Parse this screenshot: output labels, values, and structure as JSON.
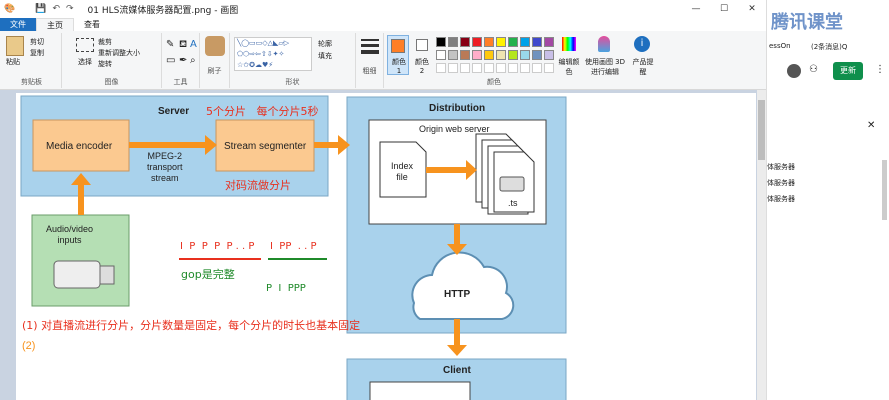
{
  "window": {
    "title": "01 HLS流媒体服务器配置.png - 画图",
    "minimize": "—",
    "maximize": "☐",
    "close": "✕"
  },
  "tabs": {
    "file": "文件",
    "home": "主页",
    "view": "查看"
  },
  "ribbon": {
    "clipboard": {
      "paste": "粘贴",
      "cut": "剪切",
      "copy": "复制",
      "label": "剪贴板"
    },
    "image": {
      "select": "选择",
      "crop": "裁剪",
      "resize": "重新调整大小",
      "rotate": "旋转",
      "label": "图像"
    },
    "tools": {
      "label": "工具"
    },
    "brushes": {
      "label": "刷子"
    },
    "shapes": {
      "outline": "轮廓",
      "fill": "填充",
      "label": "形状"
    },
    "size": {
      "label": "粗细"
    },
    "colors": {
      "color1": "颜色 1",
      "color2": "颜色 2",
      "edit": "编辑颜色",
      "paint3d": "使用画图 3D 进行编辑",
      "product": "产品提醒",
      "label": "颜色"
    }
  },
  "palette": [
    "#000000",
    "#7f7f7f",
    "#880015",
    "#ed1c24",
    "#ff7f27",
    "#fff200",
    "#22b14c",
    "#00a2e8",
    "#3f48cc",
    "#a349a4",
    "#ffffff",
    "#c3c3c3",
    "#b97a57",
    "#ffaec9",
    "#ffc90e",
    "#efe4b0",
    "#b5e61d",
    "#99d9ea",
    "#7092be",
    "#c8bfe7"
  ],
  "accent": "#f7931e",
  "diagram": {
    "server": "Server",
    "media_encoder": "Media encoder",
    "mpeg2": "MPEG-2\ntransport\nstream",
    "stream_segmenter": "Stream segmenter",
    "audio_video": "Audio/video\ninputs",
    "distribution": "Distribution",
    "origin_web_server": "Origin web server",
    "index_file": "Index\nfile",
    "ts": ".ts",
    "http": "HTTP",
    "client": "Client"
  },
  "annotations": {
    "a1": "5个分片   每个分片5秒",
    "a2": "对码流做分片",
    "a3": "I  P  P  P  P . . P",
    "a4": "I  PP  . . P",
    "a5": "gop是完整",
    "a6": "P  I  PPP",
    "a7": "(1) 对直播流进行分片，分片数量是固定，每个分片的时长也基本固定",
    "a8": "(2)"
  },
  "right_panel": {
    "brand": "腾讯课堂",
    "tab_a": "essOn",
    "tab_b": "(2条消息)Q",
    "update": "更新",
    "items": [
      "体服务器",
      "体服务器",
      "体服务器"
    ]
  }
}
